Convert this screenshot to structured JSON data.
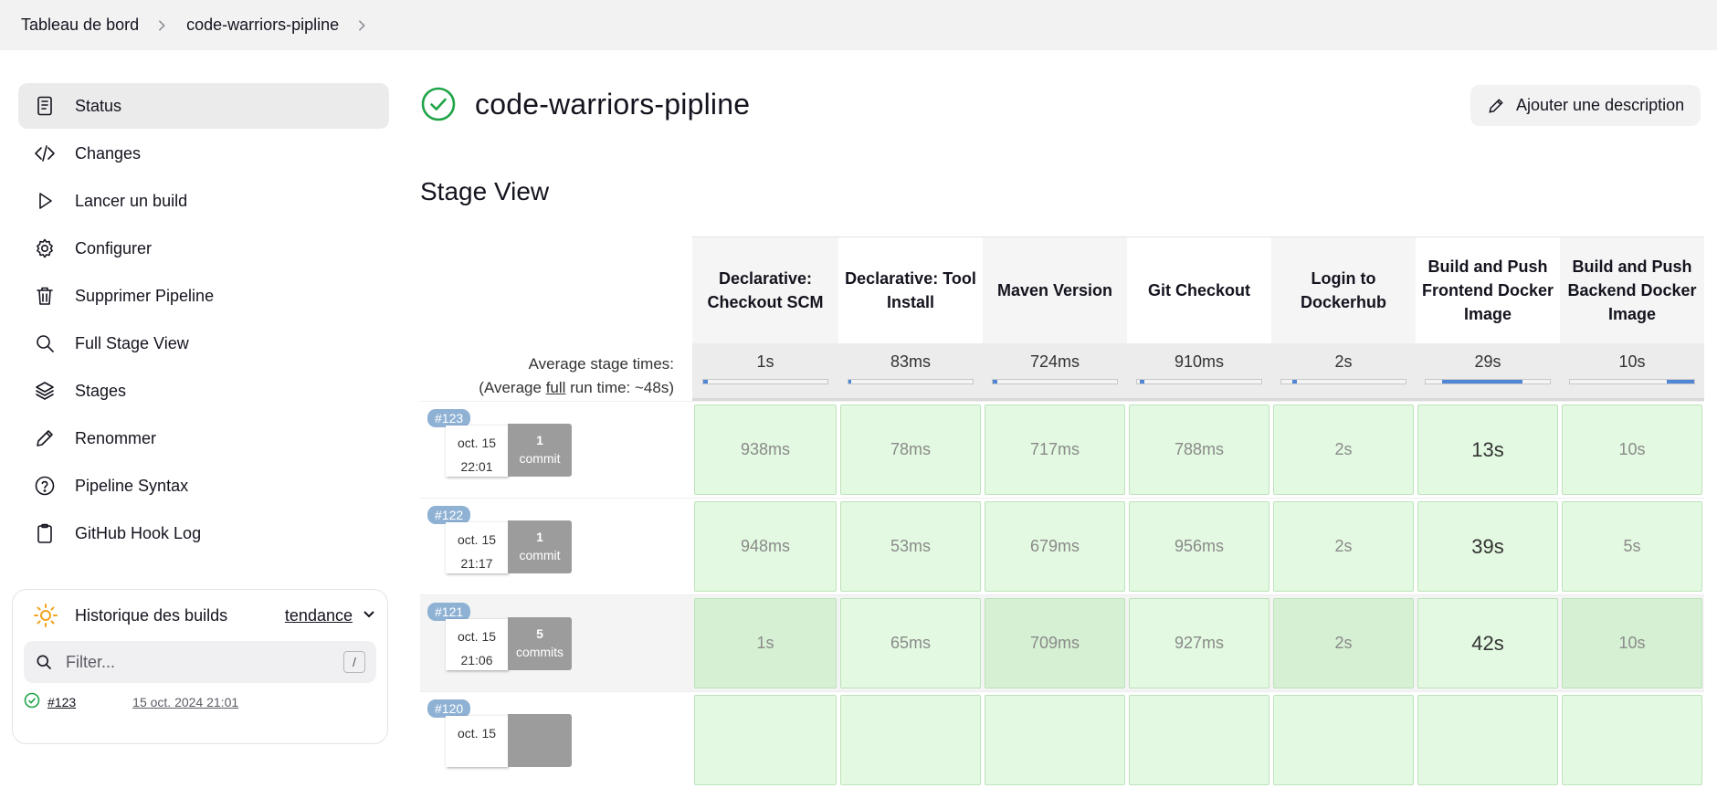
{
  "breadcrumb": [
    "Tableau de bord",
    "code-warriors-pipline"
  ],
  "sidebar": {
    "items": [
      {
        "label": "Status",
        "icon": "document-icon"
      },
      {
        "label": "Changes",
        "icon": "code-icon"
      },
      {
        "label": "Lancer un build",
        "icon": "play-icon"
      },
      {
        "label": "Configurer",
        "icon": "gear-icon"
      },
      {
        "label": "Supprimer Pipeline",
        "icon": "trash-icon"
      },
      {
        "label": "Full Stage View",
        "icon": "search-icon"
      },
      {
        "label": "Stages",
        "icon": "layers-icon"
      },
      {
        "label": "Renommer",
        "icon": "pencil-icon"
      },
      {
        "label": "Pipeline Syntax",
        "icon": "help-icon"
      },
      {
        "label": "GitHub Hook Log",
        "icon": "clipboard-icon"
      }
    ]
  },
  "history": {
    "title": "Historique des builds",
    "trend": "tendance",
    "filter_placeholder": "Filter...",
    "shortcut": "/",
    "builds": [
      {
        "number": "#123",
        "date": "15 oct. 2024 21:01"
      }
    ]
  },
  "main": {
    "title": "code-warriors-pipline",
    "description_button": "Ajouter une description",
    "stage_view_title": "Stage View"
  },
  "stage_view": {
    "avg_label": "Average stage times:",
    "avg_full_prefix": "(Average ",
    "avg_full_link": "full",
    "avg_full_suffix": " run time: ~48s)",
    "columns": [
      {
        "name": "Declarative: Checkout SCM",
        "avg": "1s",
        "bar_start": 0.0,
        "bar_end": 0.04
      },
      {
        "name": "Declarative: Tool Install",
        "avg": "83ms",
        "bar_start": 0.0,
        "bar_end": 0.02
      },
      {
        "name": "Maven Version",
        "avg": "724ms",
        "bar_start": 0.0,
        "bar_end": 0.04
      },
      {
        "name": "Git Checkout",
        "avg": "910ms",
        "bar_start": 0.02,
        "bar_end": 0.06
      },
      {
        "name": "Login to Dockerhub",
        "avg": "2s",
        "bar_start": 0.09,
        "bar_end": 0.13
      },
      {
        "name": "Build and Push Frontend Docker Image",
        "avg": "29s",
        "bar_start": 0.13,
        "bar_end": 0.78
      },
      {
        "name": "Build and Push Backend Docker Image",
        "avg": "10s",
        "bar_start": 0.78,
        "bar_end": 1.0
      }
    ],
    "builds": [
      {
        "number": "#123",
        "date": "oct. 15",
        "time": "22:01",
        "commits": "1",
        "commit_label": "commit",
        "cells": [
          "938ms",
          "78ms",
          "717ms",
          "788ms",
          "2s",
          "13s",
          "10s"
        ]
      },
      {
        "number": "#122",
        "date": "oct. 15",
        "time": "21:17",
        "commits": "1",
        "commit_label": "commit",
        "cells": [
          "948ms",
          "53ms",
          "679ms",
          "956ms",
          "2s",
          "39s",
          "5s"
        ]
      },
      {
        "number": "#121",
        "date": "oct. 15",
        "time": "21:06",
        "commits": "5",
        "commit_label": "commits",
        "cells": [
          "1s",
          "65ms",
          "709ms",
          "927ms",
          "2s",
          "42s",
          "10s"
        ]
      },
      {
        "number": "#120",
        "date": "oct. 15",
        "time": "",
        "commits": "",
        "commit_label": "",
        "cells": [
          "",
          "",
          "",
          "",
          "",
          "",
          ""
        ]
      }
    ]
  },
  "colors": {
    "success": "#1ea446",
    "stage_cell": "#e3f9e1",
    "badge": "#8fb2d4",
    "bar": "#4f87d6"
  }
}
